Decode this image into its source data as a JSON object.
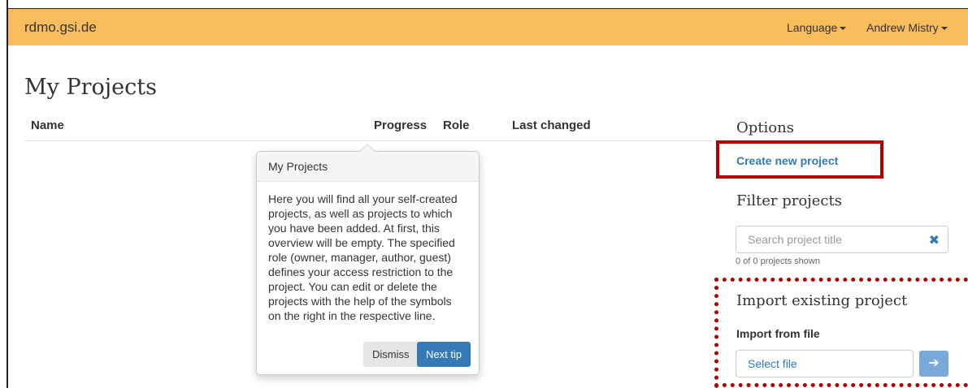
{
  "navbar": {
    "brand": "rdmo.gsi.de",
    "language_label": "Language",
    "user_label": "Andrew Mistry"
  },
  "page": {
    "title": "My Projects"
  },
  "table": {
    "columns": [
      "Name",
      "Progress",
      "Role",
      "Last changed"
    ]
  },
  "tip": {
    "title": "My Projects",
    "body": "Here you will find all your self-created projects, as well as projects to which you have been added. At first, this overview will be empty. The specified role (owner, manager, author, guest) defines your access restriction to the project. You can edit or delete the projects with the help of the symbols on the right in the respective line.",
    "dismiss_label": "Dismiss",
    "next_label": "Next tip"
  },
  "sidebar": {
    "options_heading": "Options",
    "create_link": "Create new project",
    "filter_heading": "Filter projects",
    "search_placeholder": "Search project title",
    "count_text": "0 of 0 projects shown",
    "import_heading": "Import existing project",
    "import_label": "Import from file",
    "file_placeholder": "Select file"
  },
  "colors": {
    "navbar": "#f9bd5d",
    "link": "#337ab7",
    "highlight": "#b00000"
  }
}
